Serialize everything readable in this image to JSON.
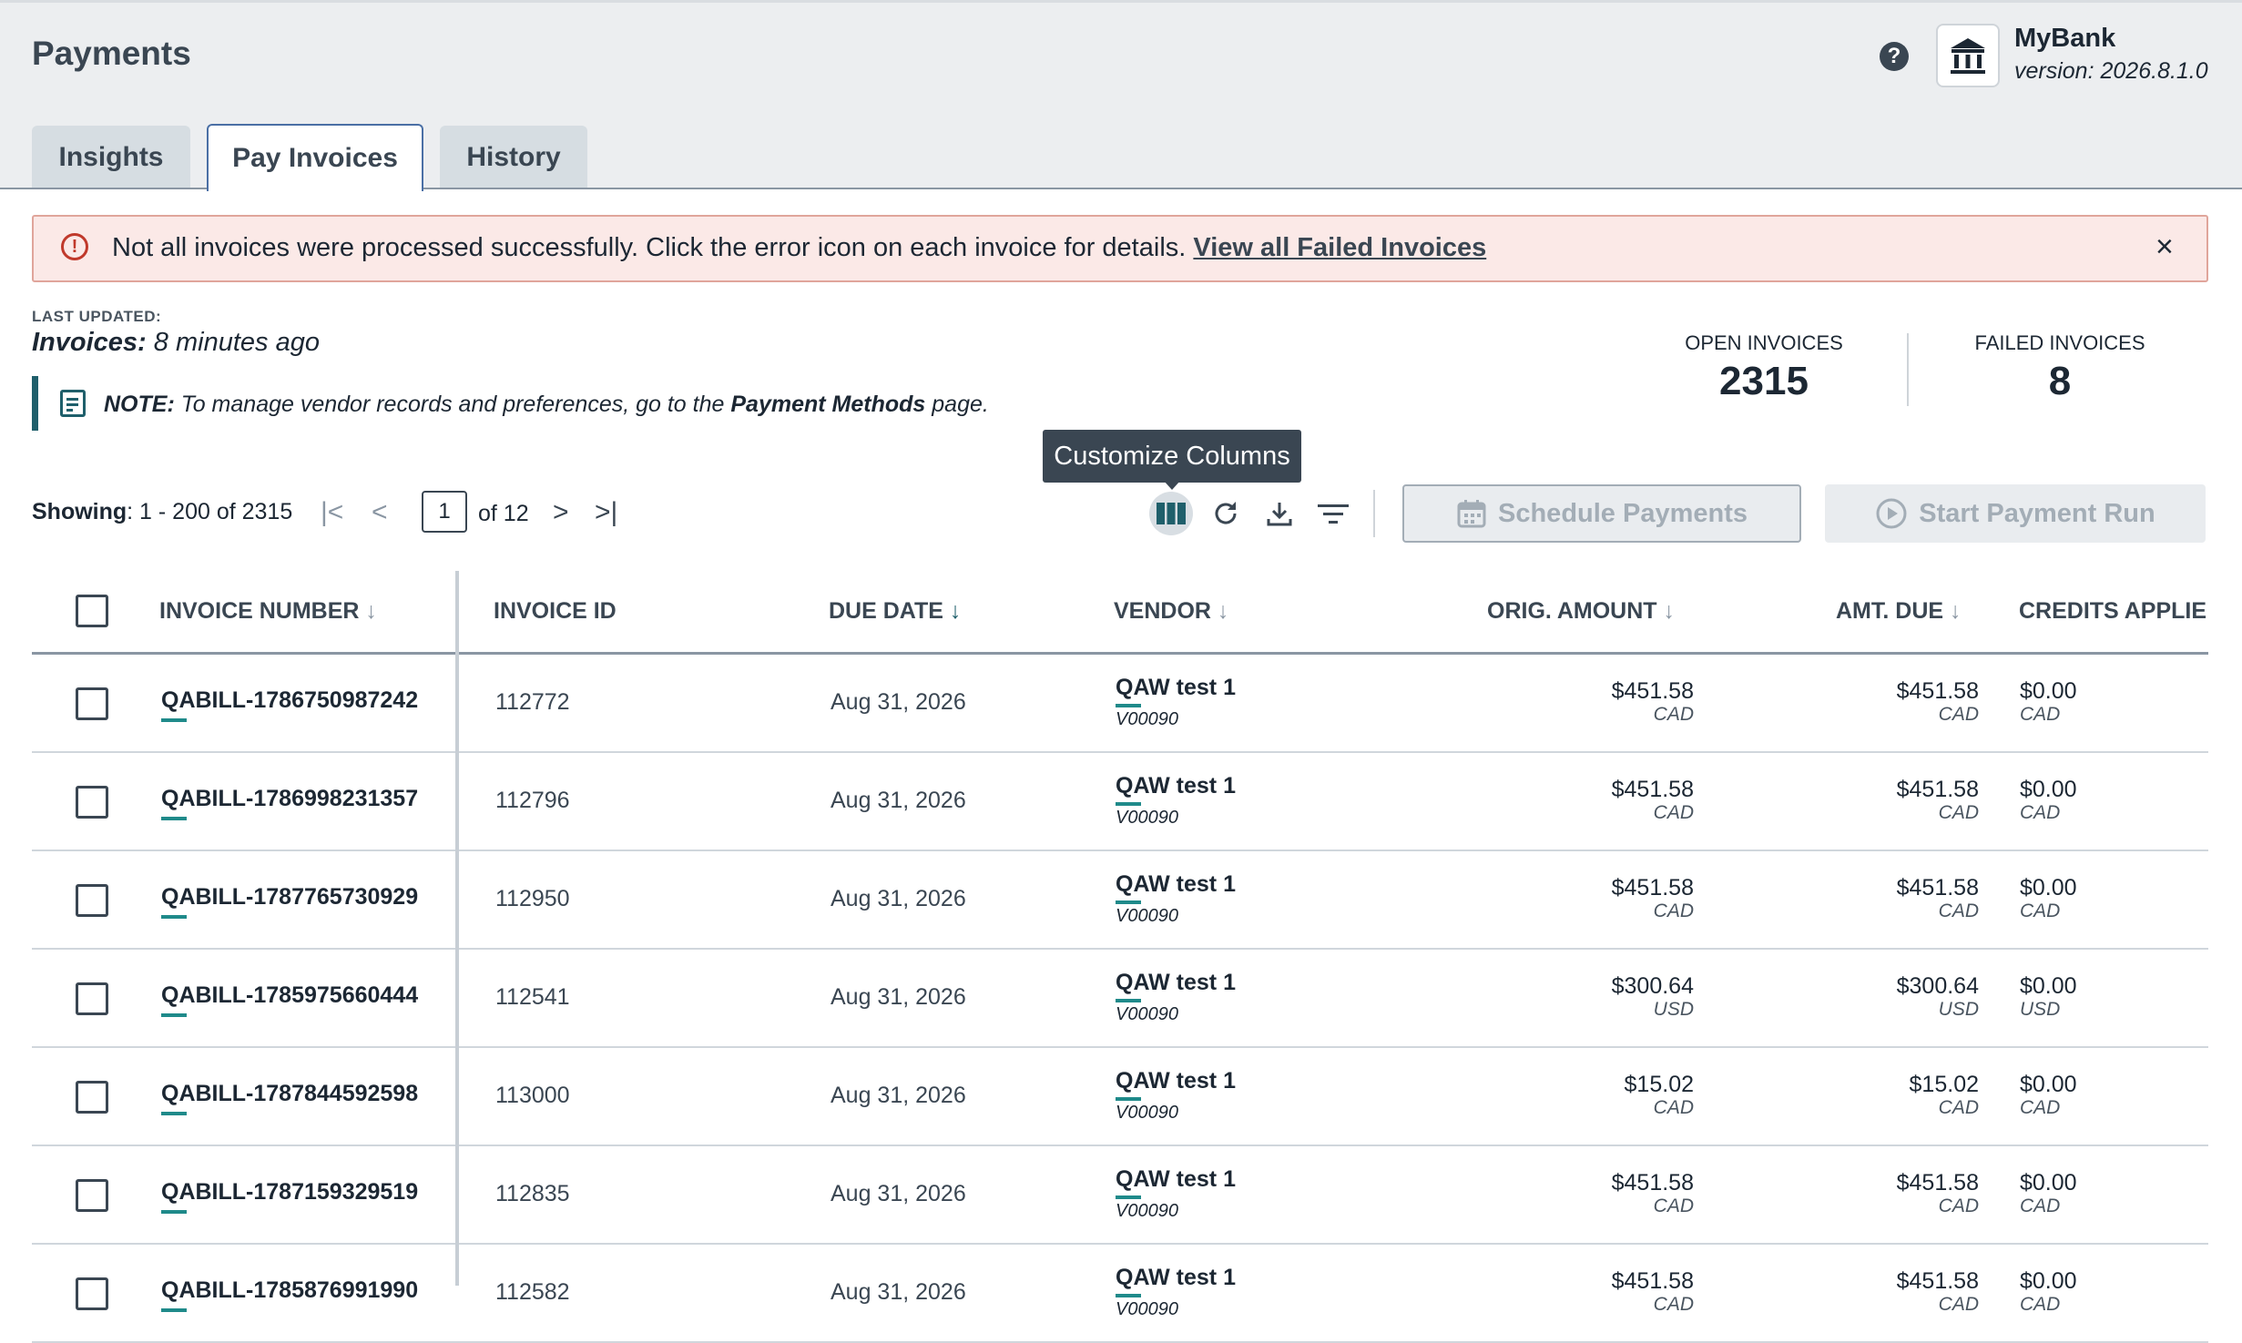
{
  "page": {
    "title": "Payments",
    "help_label": "?"
  },
  "bank": {
    "name": "MyBank",
    "version": "version: 2026.8.1.0"
  },
  "tabs": [
    {
      "label": "Insights",
      "active": false
    },
    {
      "label": "Pay Invoices",
      "active": true
    },
    {
      "label": "History",
      "active": false
    }
  ],
  "alert": {
    "message": "Not all invoices were processed successfully. Click the error icon on each invoice for details.",
    "link": "View all Failed Invoices",
    "close": "×"
  },
  "last_updated": {
    "label": "LAST UPDATED:",
    "prefix": "Invoices:",
    "value": "8 minutes ago"
  },
  "note": {
    "prefix": "NOTE:",
    "text1": "To manage vendor records and preferences, go to the",
    "link": "Payment Methods",
    "text2": "page."
  },
  "stats": {
    "open": {
      "label": "OPEN INVOICES",
      "value": "2315"
    },
    "failed": {
      "label": "FAILED INVOICES",
      "value": "8"
    }
  },
  "tooltip": "Customize Columns",
  "pagination": {
    "showing_label": "Showing",
    "range": ": 1 - 200 of 2315",
    "page": "1",
    "of": "of 12"
  },
  "buttons": {
    "schedule": "Schedule Payments",
    "start": "Start Payment Run"
  },
  "columns": [
    "INVOICE NUMBER",
    "INVOICE ID",
    "DUE DATE",
    "VENDOR",
    "ORIG. AMOUNT",
    "AMT. DUE",
    "CREDITS APPLIE"
  ],
  "rows": [
    {
      "invoice_number": "QABILL-1786750987242",
      "invoice_id": "112772",
      "due_date": "Aug 31, 2026",
      "vendor": "QAW test 1",
      "vendor_code": "V00090",
      "orig_amount": "$451.58",
      "orig_cur": "CAD",
      "amt_due": "$451.58",
      "due_cur": "CAD",
      "credits": "$0.00",
      "cred_cur": "CAD"
    },
    {
      "invoice_number": "QABILL-1786998231357",
      "invoice_id": "112796",
      "due_date": "Aug 31, 2026",
      "vendor": "QAW test 1",
      "vendor_code": "V00090",
      "orig_amount": "$451.58",
      "orig_cur": "CAD",
      "amt_due": "$451.58",
      "due_cur": "CAD",
      "credits": "$0.00",
      "cred_cur": "CAD"
    },
    {
      "invoice_number": "QABILL-1787765730929",
      "invoice_id": "112950",
      "due_date": "Aug 31, 2026",
      "vendor": "QAW test 1",
      "vendor_code": "V00090",
      "orig_amount": "$451.58",
      "orig_cur": "CAD",
      "amt_due": "$451.58",
      "due_cur": "CAD",
      "credits": "$0.00",
      "cred_cur": "CAD"
    },
    {
      "invoice_number": "QABILL-1785975660444",
      "invoice_id": "112541",
      "due_date": "Aug 31, 2026",
      "vendor": "QAW test 1",
      "vendor_code": "V00090",
      "orig_amount": "$300.64",
      "orig_cur": "USD",
      "amt_due": "$300.64",
      "due_cur": "USD",
      "credits": "$0.00",
      "cred_cur": "USD"
    },
    {
      "invoice_number": "QABILL-1787844592598",
      "invoice_id": "113000",
      "due_date": "Aug 31, 2026",
      "vendor": "QAW test 1",
      "vendor_code": "V00090",
      "orig_amount": "$15.02",
      "orig_cur": "CAD",
      "amt_due": "$15.02",
      "due_cur": "CAD",
      "credits": "$0.00",
      "cred_cur": "CAD"
    },
    {
      "invoice_number": "QABILL-1787159329519",
      "invoice_id": "112835",
      "due_date": "Aug 31, 2026",
      "vendor": "QAW test 1",
      "vendor_code": "V00090",
      "orig_amount": "$451.58",
      "orig_cur": "CAD",
      "amt_due": "$451.58",
      "due_cur": "CAD",
      "credits": "$0.00",
      "cred_cur": "CAD"
    },
    {
      "invoice_number": "QABILL-1785876991990",
      "invoice_id": "112582",
      "due_date": "Aug 31, 2026",
      "vendor": "QAW test 1",
      "vendor_code": "V00090",
      "orig_amount": "$451.58",
      "orig_cur": "CAD",
      "amt_due": "$451.58",
      "due_cur": "CAD",
      "credits": "$0.00",
      "cred_cur": "CAD"
    }
  ]
}
